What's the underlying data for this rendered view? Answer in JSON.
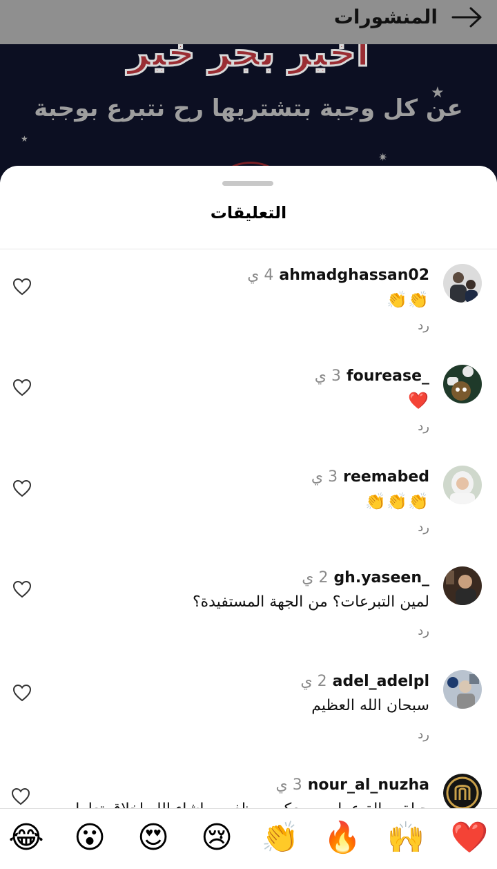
{
  "header": {
    "title": "المنشورات",
    "back_icon": "arrow-right-icon"
  },
  "banner": {
    "headline": "اخير بجر خير",
    "subline": "عن كل وجبة بتشتريها رح نتبرع بوجبة"
  },
  "sheet": {
    "title": "التعليقات"
  },
  "comments": [
    {
      "user": "ahmadghassan02",
      "time": "4 ي",
      "text": "👏👏",
      "reply": "رد"
    },
    {
      "user": "fourease_",
      "time": "3 ي",
      "text": "❤️",
      "reply": "رد"
    },
    {
      "user": "reemabed",
      "time": "3 ي",
      "text": "👏👏👏",
      "reply": "رد"
    },
    {
      "user": "gh.yaseen_",
      "time": "2 ي",
      "text": "لمين التبرعات؟ من الجهة المستفيدة؟",
      "reply": "رد"
    },
    {
      "user": "adel_adelpl",
      "time": "2 ي",
      "text": "سبحان الله العظيم",
      "reply": "رد"
    },
    {
      "user": "nour_al_nuzha",
      "time": "3 ي",
      "text": "حياة موالة عملهم ومعكم موظفين ماشاء الله اخلاق تعامل"
    }
  ],
  "reactions": [
    "❤️",
    "🙌",
    "🔥",
    "👏",
    "😢",
    "😍",
    "😮",
    "😂"
  ],
  "colors": {
    "overlay": "#8f8f8f",
    "banner_bg": "#0c0f22",
    "time": "#8a8a8a",
    "heart_red": "#e0213b"
  }
}
